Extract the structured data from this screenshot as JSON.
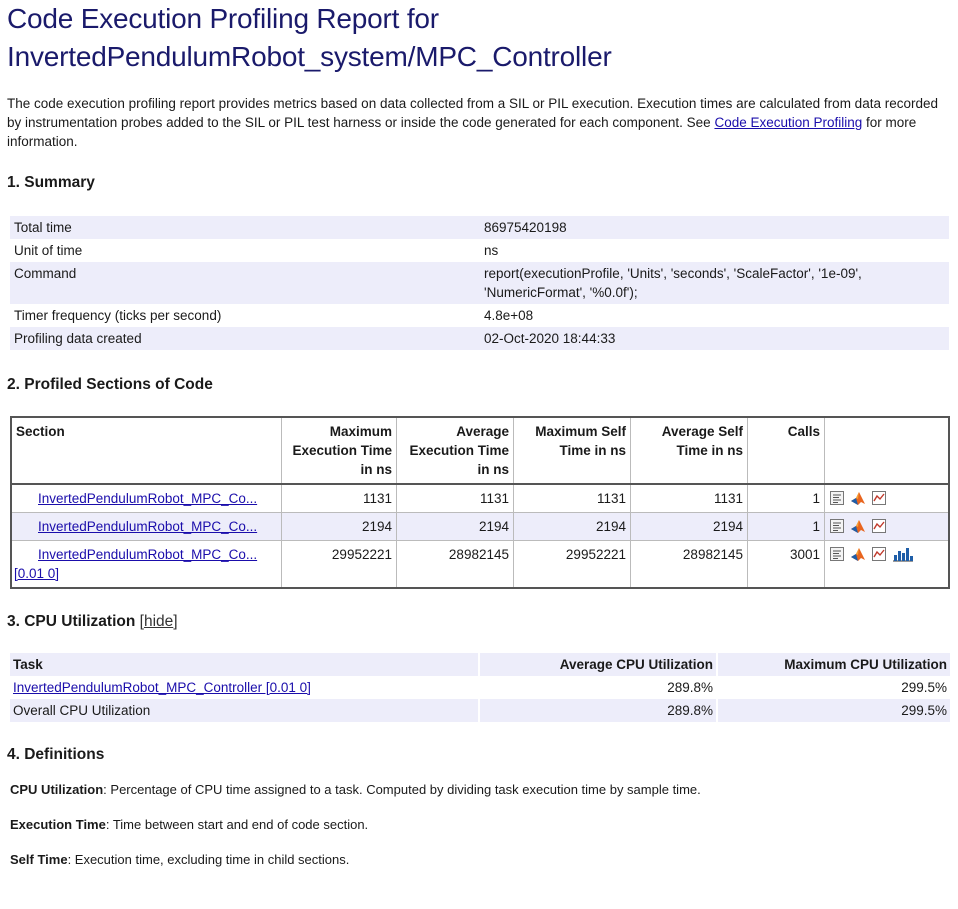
{
  "title_line1": "Code Execution Profiling Report for",
  "title_line2": "InvertedPendulumRobot_system/MPC_Controller",
  "intro": {
    "text": "The code execution profiling report provides metrics based on data collected from a SIL or PIL execution. Execution times are calculated from data recorded by instrumentation probes added to the SIL or PIL test harness or inside the code generated for each component. See ",
    "link": "Code Execution Profiling",
    "tail": " for more information."
  },
  "summary": {
    "heading": "1. Summary",
    "rows": [
      {
        "key": "Total time",
        "value": "86975420198"
      },
      {
        "key": "Unit of time",
        "value": "ns"
      },
      {
        "key": "Command",
        "value": "report(executionProfile, 'Units', 'seconds', 'ScaleFactor', '1e-09', 'NumericFormat', '%0.0f');"
      },
      {
        "key": "Timer frequency (ticks per second)",
        "value": "4.8e+08"
      },
      {
        "key": "Profiling data created",
        "value": "02-Oct-2020 18:44:33"
      }
    ]
  },
  "profiled": {
    "heading": "2. Profiled Sections of Code",
    "columns": [
      "Section",
      "Maximum Execution Time in ns",
      "Average Execution Time in ns",
      "Maximum Self Time in ns",
      "Average Self Time in ns",
      "Calls"
    ],
    "rows": [
      {
        "section": "InvertedPendulumRobot_MPC_Co...",
        "rate": "",
        "max_exec": "1131",
        "avg_exec": "1131",
        "max_self": "1131",
        "avg_self": "1131",
        "calls": "1"
      },
      {
        "section": "InvertedPendulumRobot_MPC_Co...",
        "rate": "",
        "max_exec": "2194",
        "avg_exec": "2194",
        "max_self": "2194",
        "avg_self": "2194",
        "calls": "1"
      },
      {
        "section": "InvertedPendulumRobot_MPC_Co...",
        "rate": "[0.01 0]",
        "max_exec": "29952221",
        "avg_exec": "28982145",
        "max_self": "29952221",
        "avg_self": "28982145",
        "calls": "3001"
      }
    ]
  },
  "cpu": {
    "heading": "3. CPU Utilization",
    "hide_link": "hide",
    "columns": [
      "Task",
      "Average CPU Utilization",
      "Maximum CPU Utilization"
    ],
    "rows": [
      {
        "task": "InvertedPendulumRobot_MPC_Controller [0.01 0]",
        "avg": "289.8%",
        "max": "299.5%"
      },
      {
        "task": "Overall CPU Utilization",
        "avg": "289.8%",
        "max": "299.5%"
      }
    ]
  },
  "definitions": {
    "heading": "4. Definitions",
    "items": [
      {
        "term": "CPU Utilization",
        "text": ": Percentage of CPU time assigned to a task. Computed by dividing task execution time by sample time."
      },
      {
        "term": "Execution Time",
        "text": ": Time between start and end of code section."
      },
      {
        "term": "Self Time",
        "text": ": Execution time, excluding time in child sections."
      }
    ]
  },
  "icons": [
    "code-icon",
    "matlab-icon",
    "timeline-icon",
    "histogram-icon"
  ],
  "colors": {
    "title": "#1a1a6b",
    "link": "#1a0dab",
    "row_shade": "#ededfa"
  }
}
